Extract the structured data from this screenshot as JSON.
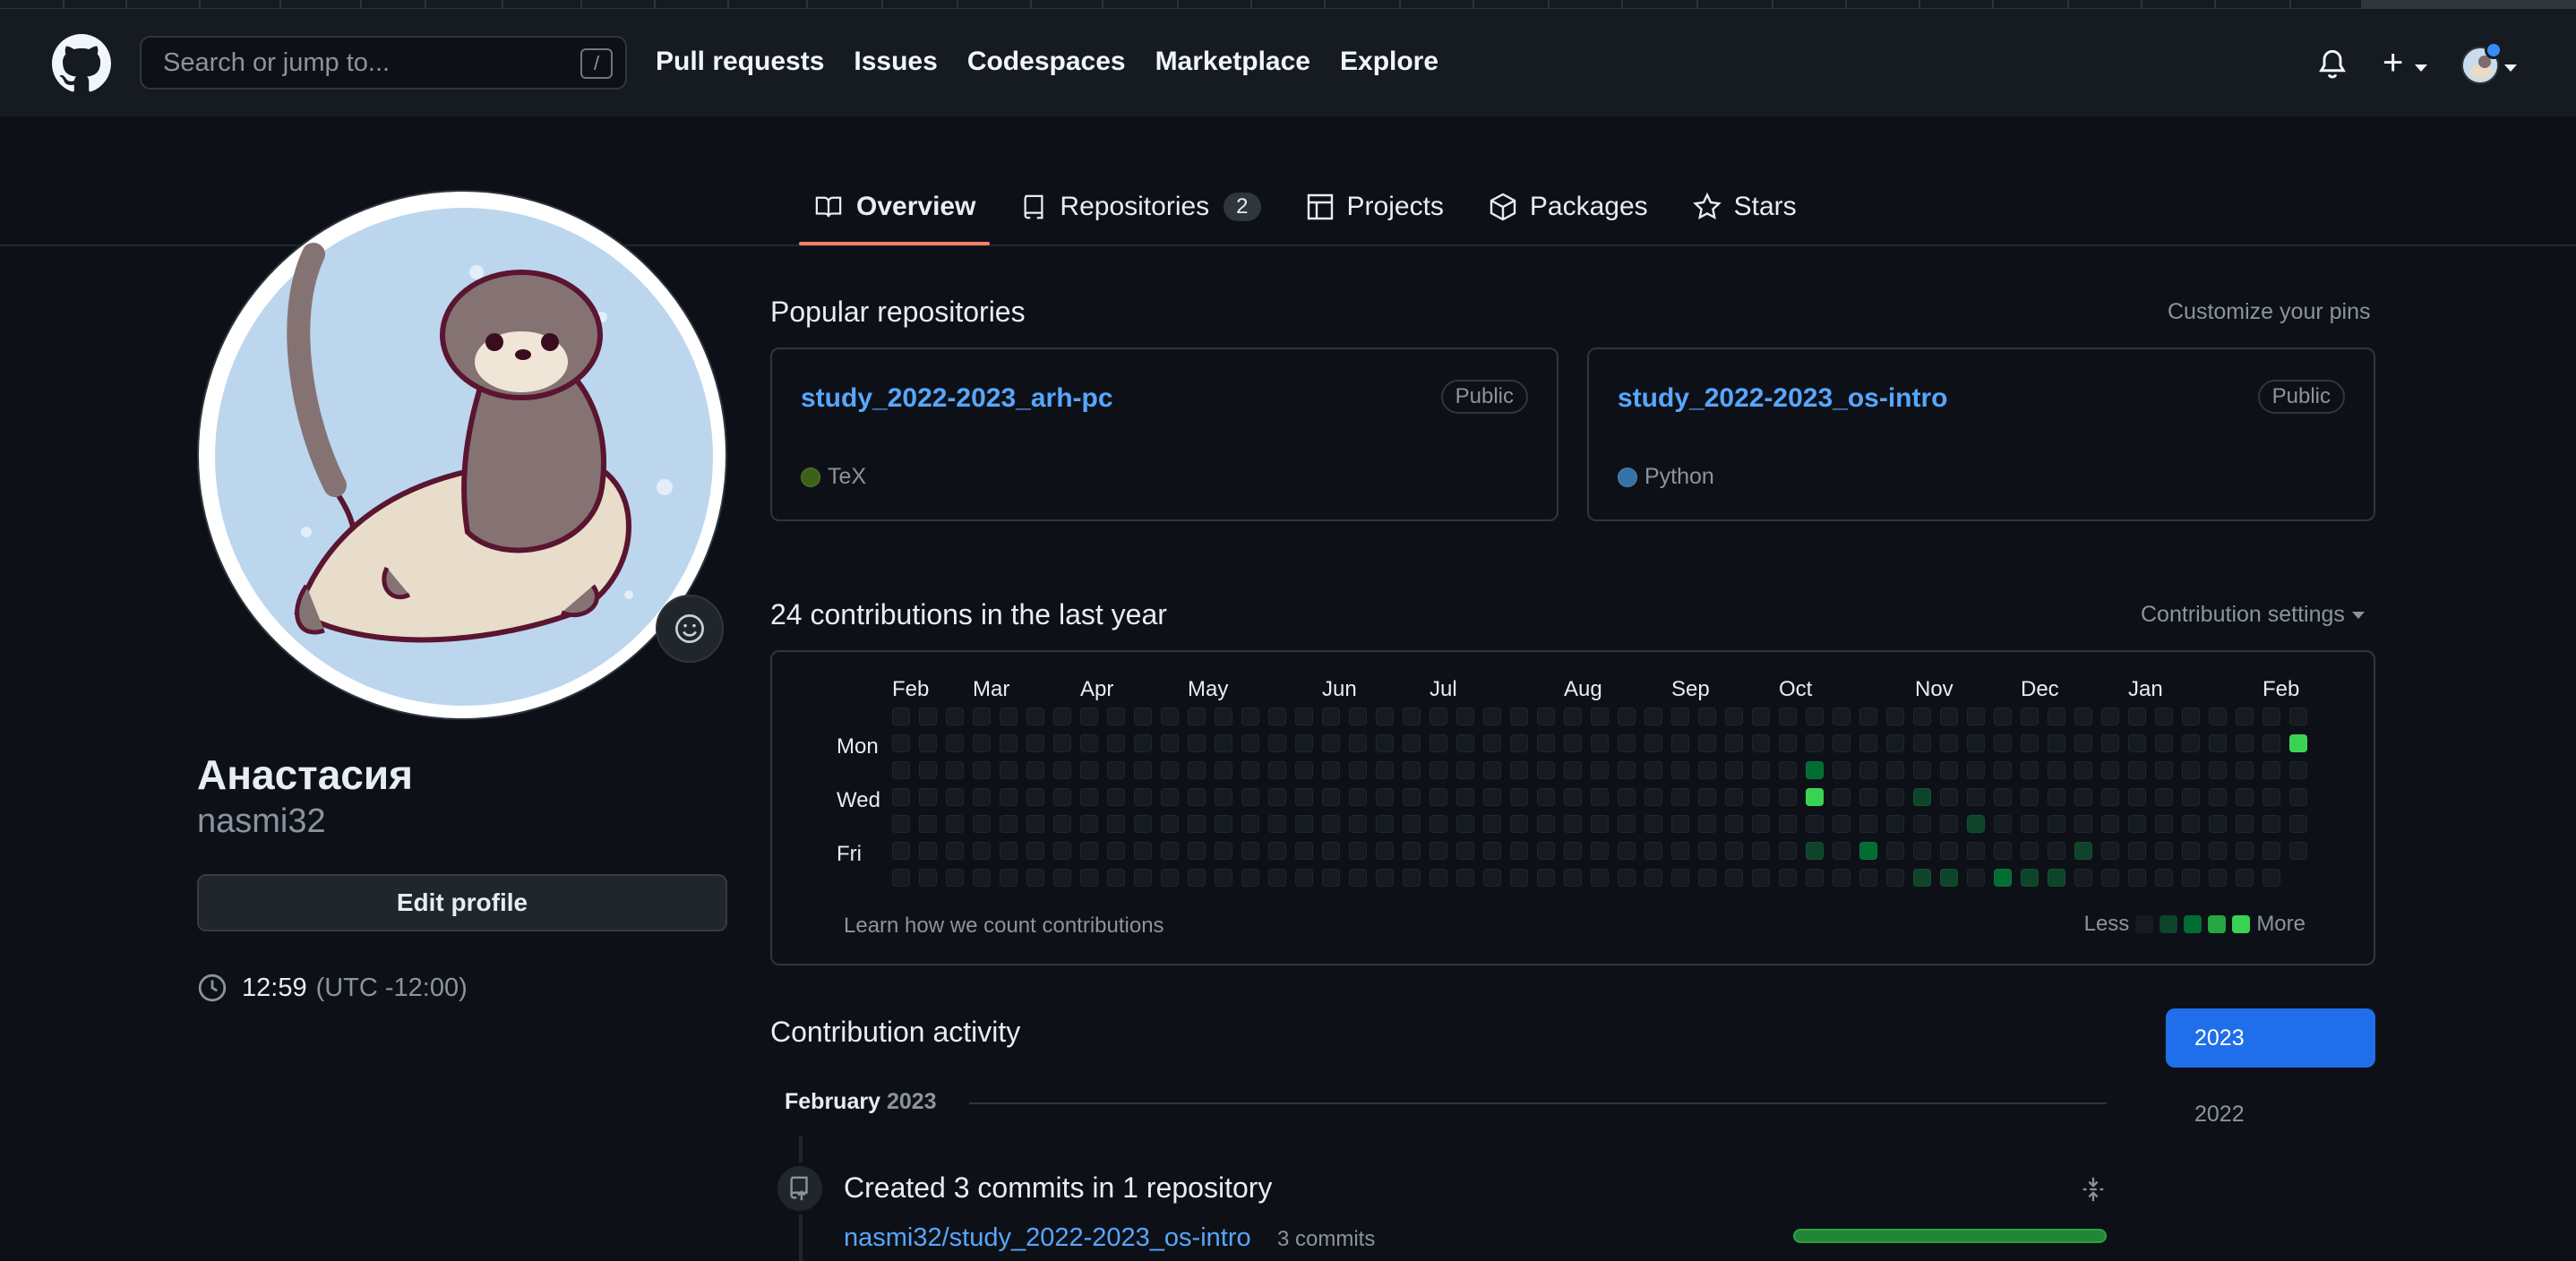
{
  "header": {
    "search_placeholder": "Search or jump to...",
    "search_shortcut": "/",
    "nav": [
      "Pull requests",
      "Issues",
      "Codespaces",
      "Marketplace",
      "Explore"
    ],
    "plus_label": "+"
  },
  "tabs": [
    {
      "label": "Overview",
      "icon": "book-icon",
      "active": true
    },
    {
      "label": "Repositories",
      "icon": "repo-icon",
      "count": "2"
    },
    {
      "label": "Projects",
      "icon": "table-icon"
    },
    {
      "label": "Packages",
      "icon": "package-icon"
    },
    {
      "label": "Stars",
      "icon": "star-icon"
    }
  ],
  "profile": {
    "name": "Анастасия",
    "username": "nasmi32",
    "edit_label": "Edit profile",
    "time": "12:59",
    "timezone": "(UTC -12:00)"
  },
  "popular": {
    "title": "Popular repositories",
    "customize": "Customize your pins",
    "repos": [
      {
        "name": "study_2022-2023_arh-pc",
        "visibility": "Public",
        "language": "TeX",
        "lang_color": "#3D6117"
      },
      {
        "name": "study_2022-2023_os-intro",
        "visibility": "Public",
        "language": "Python",
        "lang_color": "#3572A5"
      }
    ]
  },
  "contributions": {
    "title": "24 contributions in the last year",
    "settings": "Contribution settings",
    "months": [
      "Feb",
      "Mar",
      "Apr",
      "May",
      "Jun",
      "Jul",
      "Aug",
      "Sep",
      "Oct",
      "Nov",
      "Dec",
      "Jan",
      "Feb"
    ],
    "days": [
      "Mon",
      "Wed",
      "Fri"
    ],
    "learn": "Learn how we count contributions",
    "legend_less": "Less",
    "legend_more": "More",
    "level_colors": [
      "#161b22",
      "#0e4429",
      "#006d32",
      "#26a641",
      "#39d353"
    ],
    "weeks": 53,
    "active_cells": [
      {
        "week": 34,
        "day": 2,
        "level": 2
      },
      {
        "week": 34,
        "day": 3,
        "level": 4
      },
      {
        "week": 34,
        "day": 5,
        "level": 1
      },
      {
        "week": 36,
        "day": 5,
        "level": 2
      },
      {
        "week": 38,
        "day": 3,
        "level": 1
      },
      {
        "week": 38,
        "day": 6,
        "level": 1
      },
      {
        "week": 39,
        "day": 6,
        "level": 1
      },
      {
        "week": 40,
        "day": 4,
        "level": 1
      },
      {
        "week": 41,
        "day": 6,
        "level": 2
      },
      {
        "week": 42,
        "day": 6,
        "level": 1
      },
      {
        "week": 43,
        "day": 6,
        "level": 1
      },
      {
        "week": 44,
        "day": 5,
        "level": 1
      },
      {
        "week": 52,
        "day": 1,
        "level": 4
      }
    ]
  },
  "activity": {
    "title": "Contribution activity",
    "month": "February",
    "year": "2023",
    "years": [
      "2023",
      "2022"
    ],
    "event_title": "Created 3 commits in 1 repository",
    "repo": "nasmi32/study_2022-2023_os-intro",
    "count": "3 commits",
    "bar_fraction": 1.0
  }
}
